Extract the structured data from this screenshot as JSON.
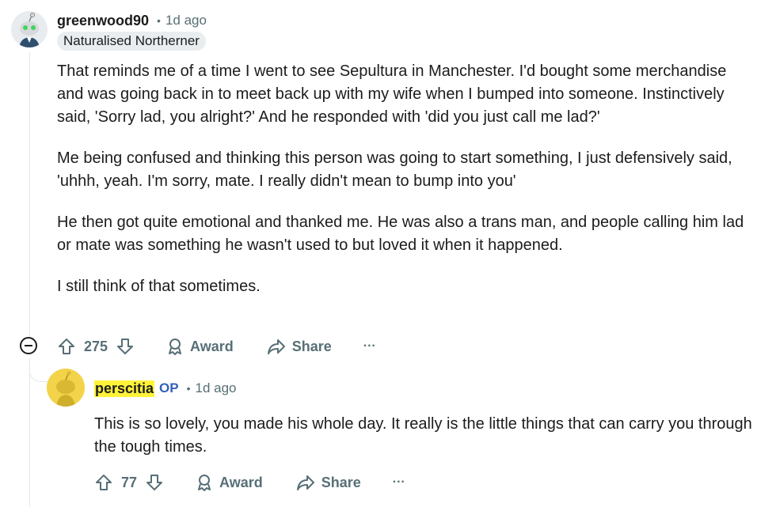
{
  "comment": {
    "username": "greenwood90",
    "time": "1d ago",
    "flair": "Naturalised Northerner",
    "paragraphs": [
      "That reminds me of a time I went to see Sepultura in Manchester. I'd bought some merchandise and was going back in to meet back up with my wife when I bumped into someone. Instinctively said, 'Sorry lad, you alright?' And he responded with 'did you just call me lad?'",
      "Me being confused and thinking this person was going to start something, I just defensively said, 'uhhh, yeah. I'm sorry, mate. I really didn't mean to bump into you'",
      "He then got quite emotional and thanked me. He was also a trans man, and people calling him lad or mate was something he wasn't used to but loved it when it happened.",
      "I still think of that sometimes."
    ],
    "votes": "275",
    "award_label": "Award",
    "share_label": "Share",
    "more_label": "···"
  },
  "reply": {
    "username": "perscitia",
    "op_badge": "OP",
    "time": "1d ago",
    "paragraphs": [
      "This is so lovely, you made his whole day. It really is the little things that can carry you through the tough times."
    ],
    "votes": "77",
    "award_label": "Award",
    "share_label": "Share",
    "more_label": "···"
  },
  "colors": {
    "text": "#1c1c1c",
    "muted": "#576f76",
    "flair_bg": "#e9edf0",
    "highlight": "#fff33a",
    "op": "#3560b8"
  }
}
